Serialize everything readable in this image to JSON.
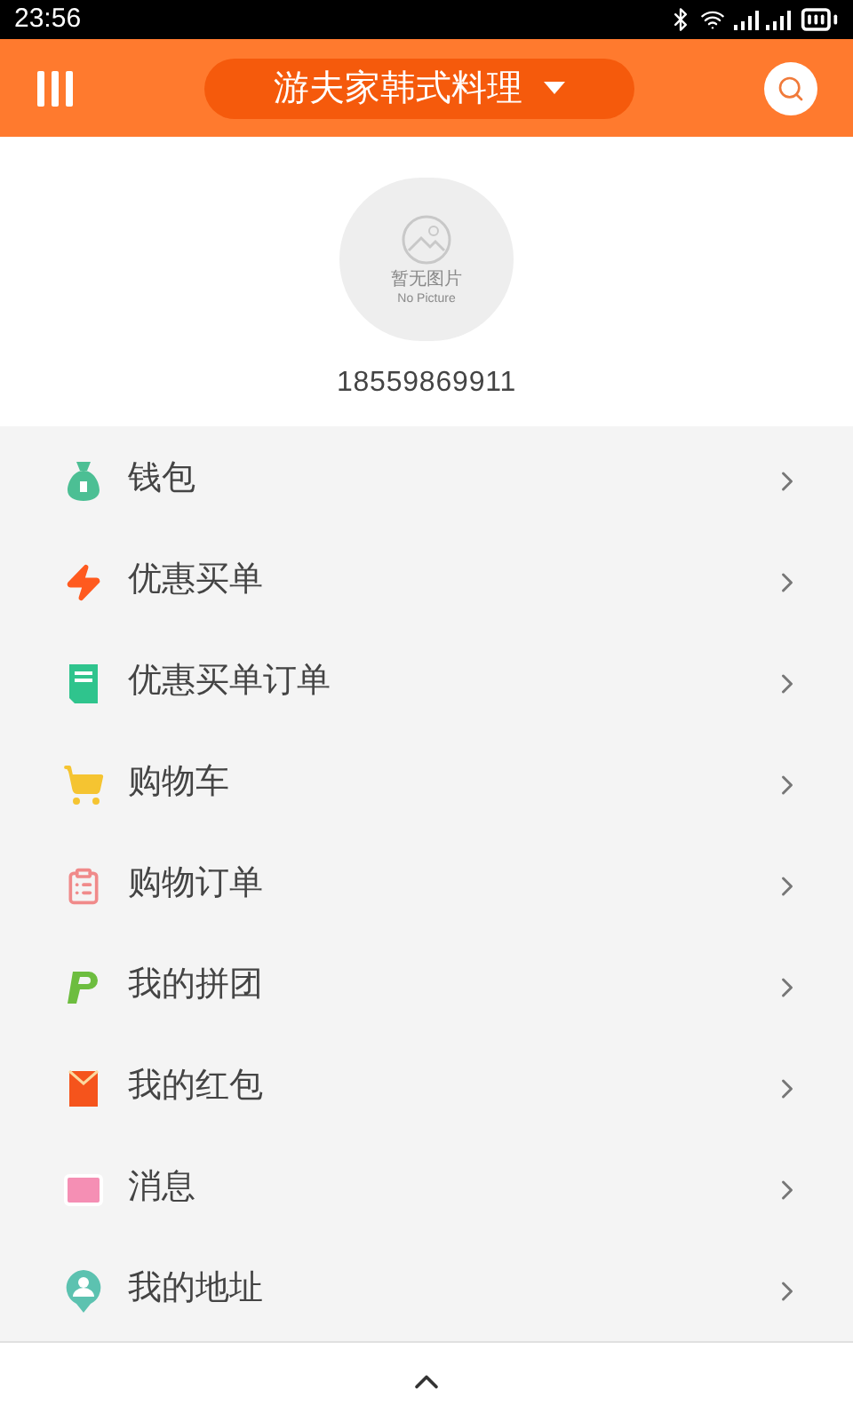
{
  "status_bar": {
    "time": "23:56"
  },
  "header": {
    "store": "游夫家韩式料理"
  },
  "profile": {
    "avatar_caption": "暂无图片",
    "avatar_caption_en": "No Picture",
    "phone": "18559869911"
  },
  "menu": [
    {
      "label": "钱包",
      "kind": "wallet",
      "color": "#4cbf94"
    },
    {
      "label": "优惠买单",
      "kind": "flash",
      "color": "#ff5a1f"
    },
    {
      "label": "优惠买单订单",
      "kind": "bill",
      "color": "#2fc48d"
    },
    {
      "label": "购物车",
      "kind": "cart",
      "color": "#f5c431"
    },
    {
      "label": "购物订单",
      "kind": "list",
      "color": "#f08a8a"
    },
    {
      "label": "我的拼团",
      "kind": "group",
      "color": "#6dbd3f"
    },
    {
      "label": "我的红包",
      "kind": "redpacket",
      "color": "#f5541c"
    },
    {
      "label": "消息",
      "kind": "mail",
      "color": "#f58fb4"
    },
    {
      "label": "我的地址",
      "kind": "address",
      "color": "#5cc2b0"
    }
  ]
}
